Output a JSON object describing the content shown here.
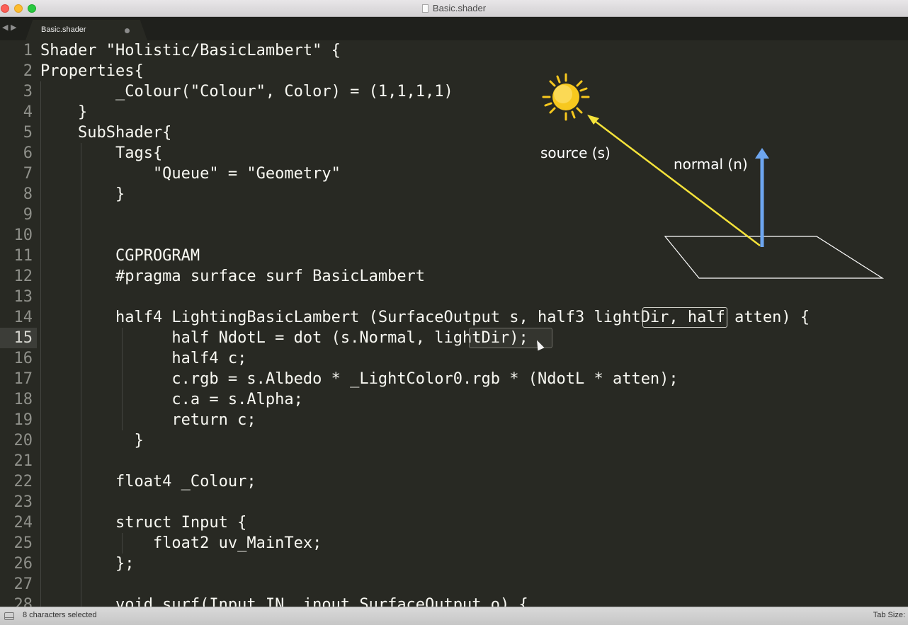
{
  "window": {
    "title": "Basic.shader"
  },
  "tabbar": {
    "back_glyph": "◀",
    "forward_glyph": "▶",
    "tab_label": "Basic.shader"
  },
  "editor": {
    "current_line": 15,
    "lines": [
      {
        "num": "1",
        "text": "Shader \"Holistic/BasicLambert\" {"
      },
      {
        "num": "2",
        "text": "Properties{"
      },
      {
        "num": "3",
        "text": "        _Colour(\"Colour\", Color) = (1,1,1,1)"
      },
      {
        "num": "4",
        "text": "    }"
      },
      {
        "num": "5",
        "text": "    SubShader{"
      },
      {
        "num": "6",
        "text": "        Tags{"
      },
      {
        "num": "7",
        "text": "            \"Queue\" = \"Geometry\""
      },
      {
        "num": "8",
        "text": "        }"
      },
      {
        "num": "9",
        "text": ""
      },
      {
        "num": "10",
        "text": ""
      },
      {
        "num": "11",
        "text": "        CGPROGRAM"
      },
      {
        "num": "12",
        "text": "        #pragma surface surf BasicLambert"
      },
      {
        "num": "13",
        "text": ""
      },
      {
        "num": "14",
        "text": "        half4 LightingBasicLambert (SurfaceOutput s, half3 lightDir, half atten) {"
      },
      {
        "num": "15",
        "text": "              half NdotL = dot (s.Normal, lightDir);"
      },
      {
        "num": "16",
        "text": "              half4 c;"
      },
      {
        "num": "17",
        "text": "              c.rgb = s.Albedo * _LightColor0.rgb * (NdotL * atten);"
      },
      {
        "num": "18",
        "text": "              c.a = s.Alpha;"
      },
      {
        "num": "19",
        "text": "              return c;"
      },
      {
        "num": "20",
        "text": "          }"
      },
      {
        "num": "21",
        "text": ""
      },
      {
        "num": "22",
        "text": "        float4 _Colour;"
      },
      {
        "num": "23",
        "text": ""
      },
      {
        "num": "24",
        "text": "        struct Input {"
      },
      {
        "num": "25",
        "text": "            float2 uv_MainTex;"
      },
      {
        "num": "26",
        "text": "        };"
      },
      {
        "num": "27",
        "text": ""
      },
      {
        "num": "28",
        "text": "        void surf(Input IN, inout SurfaceOutput o) {"
      }
    ]
  },
  "diagram": {
    "source_label": "source (s)",
    "normal_label": "normal (n)",
    "colors": {
      "light_ray": "#f5e33a",
      "normal_arrow": "#6ea6f0",
      "plane": "#ffffff",
      "sun": "#f7c81e"
    }
  },
  "statusbar": {
    "selection": "8 characters selected",
    "tab_size": "Tab Size:"
  }
}
